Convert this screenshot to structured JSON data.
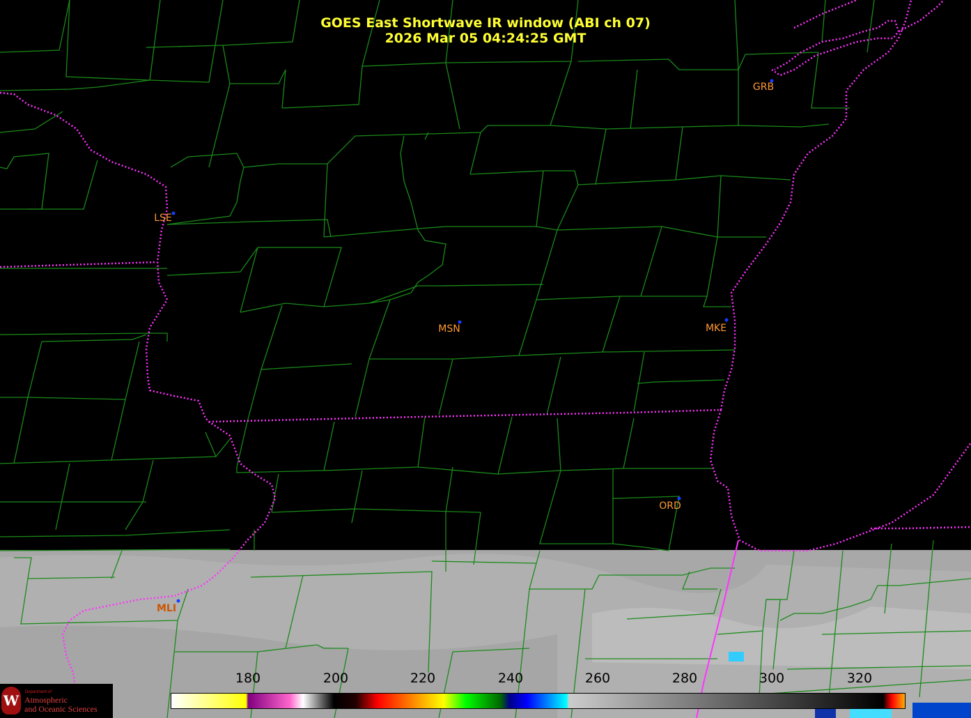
{
  "title": {
    "line1": "GOES East Shortwave IR window (ABI ch 07)",
    "line2": "2026 Mar 05  04:24:25 GMT"
  },
  "cities": [
    {
      "code": "GRB",
      "style": "normal"
    },
    {
      "code": "LSE",
      "style": "normal"
    },
    {
      "code": "MSN",
      "style": "normal"
    },
    {
      "code": "MKE",
      "style": "normal"
    },
    {
      "code": "ORD",
      "style": "normal"
    },
    {
      "code": "MLI",
      "style": "dark"
    }
  ],
  "colorbar": {
    "ticks": [
      "180",
      "200",
      "220",
      "240",
      "260",
      "280",
      "300",
      "320"
    ],
    "range": [
      163,
      330
    ],
    "stops": [
      {
        "value": 163,
        "color": "#ffffff"
      },
      {
        "value": 177,
        "color": "#ffff33"
      },
      {
        "value": 180,
        "color": "#ffff00"
      },
      {
        "value": 180.5,
        "color": "#800080"
      },
      {
        "value": 190,
        "color": "#ff66cc"
      },
      {
        "value": 193,
        "color": "#ffffff"
      },
      {
        "value": 200,
        "color": "#000000"
      },
      {
        "value": 205,
        "color": "#200000"
      },
      {
        "value": 210,
        "color": "#ff0000"
      },
      {
        "value": 220,
        "color": "#ffaa00"
      },
      {
        "value": 225,
        "color": "#ffff00"
      },
      {
        "value": 230,
        "color": "#00ff00"
      },
      {
        "value": 238,
        "color": "#006600"
      },
      {
        "value": 240,
        "color": "#000088"
      },
      {
        "value": 244,
        "color": "#0000ff"
      },
      {
        "value": 253,
        "color": "#00ffff"
      },
      {
        "value": 253.5,
        "color": "#cccccc"
      },
      {
        "value": 325,
        "color": "#000000"
      },
      {
        "value": 327,
        "color": "#ff0000"
      },
      {
        "value": 330,
        "color": "#ffaa00"
      }
    ]
  },
  "imagery": {
    "cloud_top_color": "#000000",
    "clear_ground_color": "#a8a8a8",
    "county_line_color": "#1a8a1a",
    "state_line_color": "#ff33ff"
  },
  "logo": {
    "department": "Department of",
    "line1": "Atmospheric",
    "line2": "and Oceanic Sciences",
    "seal_letter": "W"
  }
}
